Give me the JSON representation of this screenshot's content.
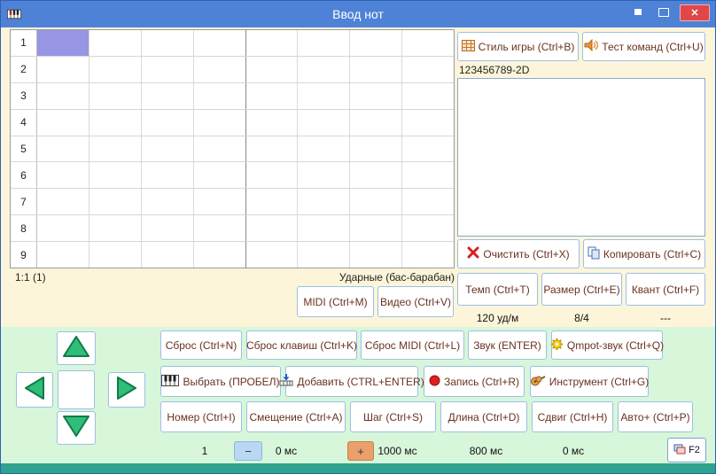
{
  "window": {
    "title": "Ввод нот",
    "close_glyph": "✕"
  },
  "grid": {
    "row_numbers": [
      "1",
      "2",
      "3",
      "4",
      "5",
      "6",
      "7",
      "8",
      "9"
    ],
    "columns": 8,
    "selected_row": 0,
    "selected_col": 0
  },
  "status": {
    "position": "1:1 (1)",
    "instrument": "Ударные (бас-барабан)"
  },
  "panel_right": {
    "style": "Стиль игры (Ctrl+B)",
    "test": "Тест команд (Ctrl+U)",
    "channels": "123456789-2D",
    "clear": "Очистить (Ctrl+X)",
    "copy": "Копировать (Ctrl+C)",
    "tempo": "Темп (Ctrl+T)",
    "meter": "Размер (Ctrl+E)",
    "quant": "Квант (Ctrl+F)",
    "tempo_value": "120 уд/м",
    "meter_value": "8/4",
    "quant_value": "---",
    "midi": "MIDI (Ctrl+M)",
    "video": "Видео (Ctrl+V)"
  },
  "panel_bottom": {
    "reset": "Сброс (Ctrl+N)",
    "reset_keys": "Сброс клавиш (Ctrl+K)",
    "reset_midi": "Сброс MIDI (Ctrl+L)",
    "sound": "Звук (ENTER)",
    "qmpot": "Qmpot-звук (Ctrl+Q)",
    "select": "Выбрать (ПРОБЕЛ)",
    "add": "Добавить (CTRL+ENTER)",
    "record": "Запись (Ctrl+R)",
    "instrument": "Инструмент (Ctrl+G)",
    "number": "Номер (Ctrl+I)",
    "offset": "Смещение (Ctrl+A)",
    "step": "Шаг (Ctrl+S)",
    "length": "Длина (Ctrl+D)",
    "shift": "Сдвиг (Ctrl+H)",
    "auto": "Авто+ (Ctrl+P)",
    "number_value": "1",
    "minus": "−",
    "offset_value": "0 мс",
    "plus": "+",
    "step_value": "1000 мс",
    "length_value": "800 мс",
    "shift_value": "0 мс",
    "f2": "F2"
  },
  "colors": {
    "titlebar": "#4e82d6",
    "top_bg": "#fdf5da",
    "bottom_bg": "#d8f6da",
    "strip": "#2ea38f",
    "selected_cell": "#9696e4",
    "button_text": "#6a3121"
  }
}
